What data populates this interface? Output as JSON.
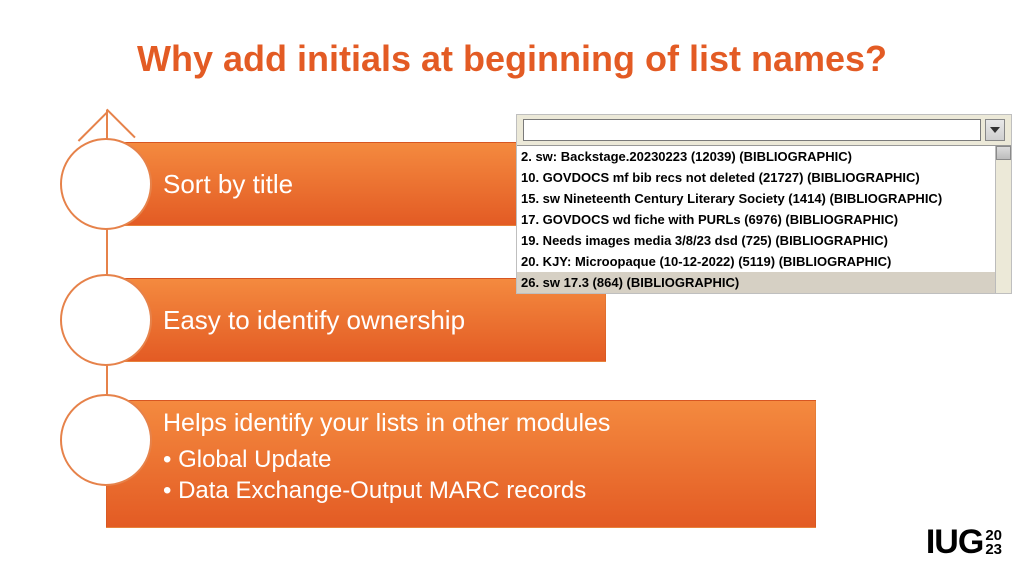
{
  "title": "Why add initials at beginning of list names?",
  "items": [
    {
      "label": "Sort by title"
    },
    {
      "label": "Easy to identify ownership"
    },
    {
      "label": "Helps identify your lists in other modules",
      "sub": [
        "Global Update",
        "Data Exchange-Output MARC records"
      ]
    }
  ],
  "dropdown": {
    "rows": [
      "2. sw: Backstage.20230223 (12039) (BIBLIOGRAPHIC)",
      "10. GOVDOCS mf bib recs not deleted (21727) (BIBLIOGRAPHIC)",
      "15. sw Nineteenth Century Literary Society (1414) (BIBLIOGRAPHIC)",
      "17. GOVDOCS wd fiche with PURLs (6976) (BIBLIOGRAPHIC)",
      "19. Needs images media 3/8/23 dsd (725) (BIBLIOGRAPHIC)",
      "20. KJY: Microopaque (10-12-2022) (5119) (BIBLIOGRAPHIC)",
      "26. sw 17.3 (864) (BIBLIOGRAPHIC)"
    ],
    "selected_index": 6
  },
  "logo": {
    "text": "IUG",
    "year_top": "20",
    "year_bottom": "23"
  }
}
